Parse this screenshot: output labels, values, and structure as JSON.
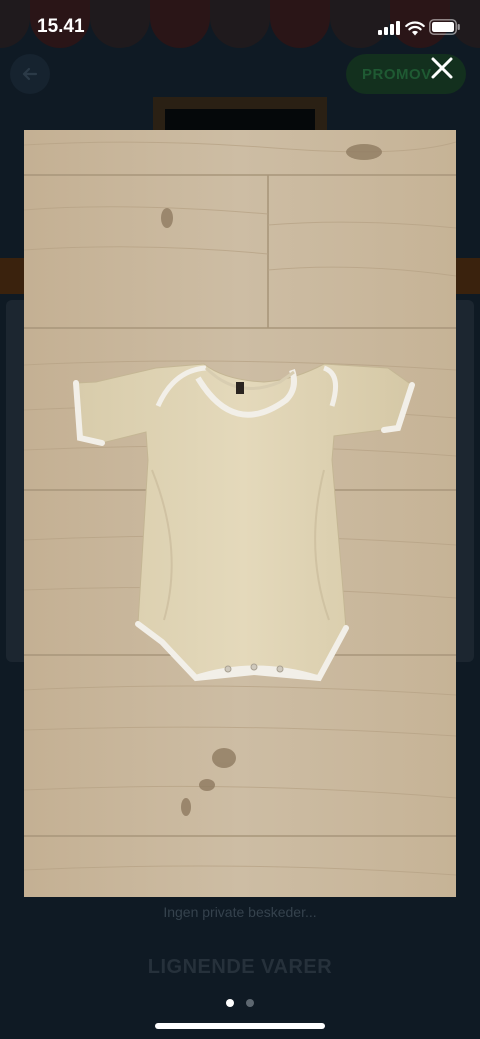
{
  "status_bar": {
    "time": "15.41"
  },
  "background": {
    "promo_label": "PROMOV",
    "private_messages": "Ingen private beskeder...",
    "similar_items_heading": "LIGNENDE VARER"
  },
  "gallery": {
    "image_description_icon": "baby-bodysuit-photo",
    "current_index": 1,
    "total_images": 2
  },
  "icons": {
    "close": "close-icon",
    "back": "arrow-left-icon"
  },
  "colors": {
    "overlay": "#0f1a24",
    "wood": "#c9b79e",
    "bodysuit": "#e0d4b4",
    "trim": "#f3f1ec"
  }
}
